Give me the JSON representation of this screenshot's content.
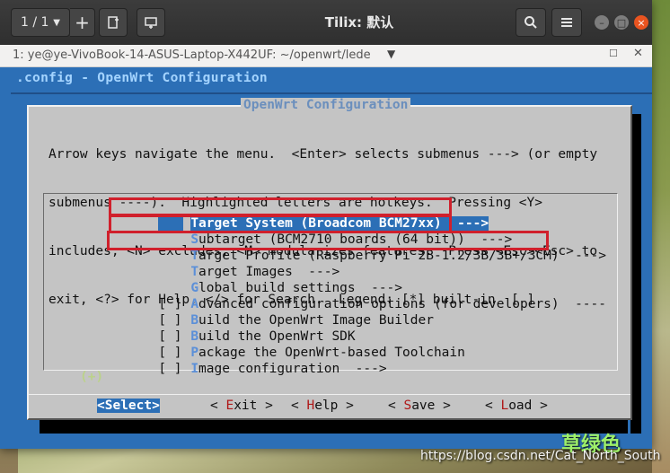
{
  "window": {
    "title": "Tilix: 默认",
    "session_selector": "1 / 1",
    "terminal_tab_title": "1: ye@ye-VivoBook-14-ASUS-Laptop-X442UF: ~/openwrt/lede"
  },
  "config": {
    "header": ".config - OpenWrt Configuration",
    "dialog_title": "OpenWrt Configuration",
    "help_lines": [
      "Arrow keys navigate the menu.  <Enter> selects submenus ---> (or empty",
      "submenus ----).  Highlighted letters are hotkeys.  Pressing <Y>",
      "includes, <N> excludes, <M> modularizes features.  Press <Esc><Esc> to",
      "exit, <?> for Help, </> for Search.  Legend: [*] built-in  [ ]"
    ],
    "menu_items": [
      {
        "marker": "",
        "hotkey": "T",
        "rest": "arget System (Broadcom BCM27xx)  --->",
        "selected": true
      },
      {
        "marker": "",
        "hotkey": "S",
        "rest": "ubtarget (BCM2710 boards (64 bit))  --->"
      },
      {
        "marker": "",
        "hotkey": "T",
        "rest": "arget Profile (Raspberry Pi 2B-1.2/3B/3B+/3CM)  --->"
      },
      {
        "marker": "",
        "hotkey": "T",
        "rest": "arget Images  --->"
      },
      {
        "marker": "",
        "hotkey": "G",
        "rest": "lobal build settings  --->"
      },
      {
        "marker": "[ ]",
        "hotkey": "A",
        "rest": "dvanced configuration options (for developers)  ----"
      },
      {
        "marker": "[ ]",
        "hotkey": "B",
        "rest": "uild the OpenWrt Image Builder"
      },
      {
        "marker": "[ ]",
        "hotkey": "B",
        "rest": "uild the OpenWrt SDK"
      },
      {
        "marker": "[ ]",
        "hotkey": "P",
        "rest": "ackage the OpenWrt-based Toolchain"
      },
      {
        "marker": "[ ]",
        "hotkey": "I",
        "rest": "mage configuration  --->"
      }
    ],
    "more_indicator": "(+)",
    "buttons": [
      {
        "label": "<Select>",
        "active": true
      },
      {
        "pre": "< ",
        "hotkey": "E",
        "rest": "xit >"
      },
      {
        "pre": "< ",
        "hotkey": "H",
        "rest": "elp >"
      },
      {
        "pre": "< ",
        "hotkey": "S",
        "rest": "ave >"
      },
      {
        "pre": "< ",
        "hotkey": "L",
        "rest": "oad >"
      }
    ]
  },
  "watermark": {
    "chinese": "草绿色",
    "url": "https://blog.csdn.net/Cat_North_South"
  },
  "colors": {
    "terminal_bg": "#2c6fb6",
    "dialog_bg": "#c4c4c4",
    "highlight_box": "#d0202c"
  }
}
